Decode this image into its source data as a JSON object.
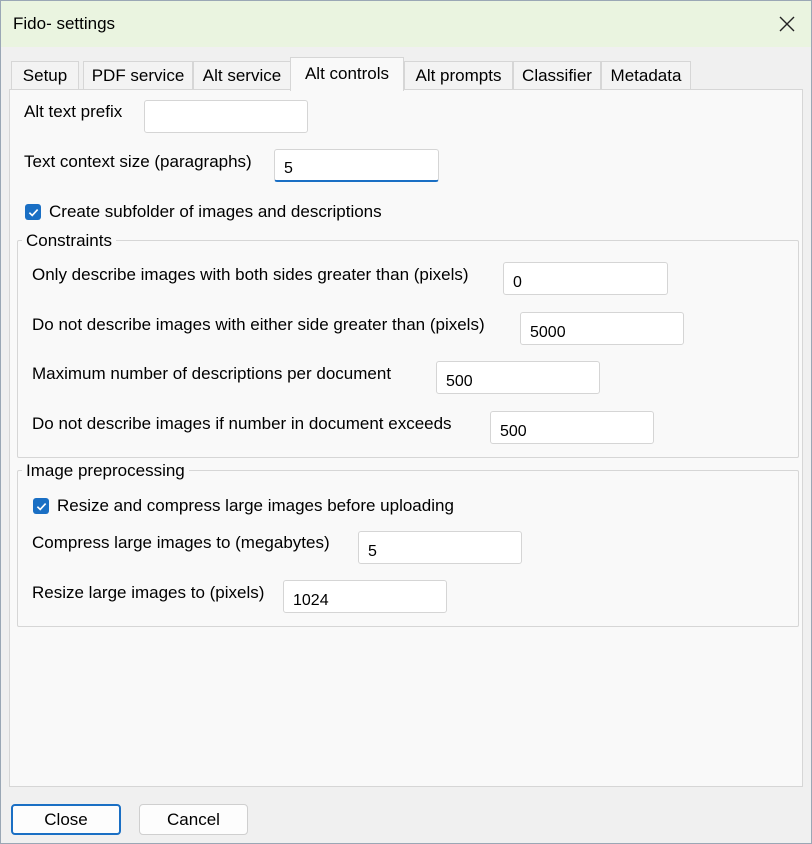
{
  "window": {
    "title": "Fido- settings"
  },
  "tabs": [
    {
      "label": "Setup",
      "active": false
    },
    {
      "label": "PDF service",
      "active": false
    },
    {
      "label": "Alt service",
      "active": false
    },
    {
      "label": "Alt controls",
      "active": true
    },
    {
      "label": "Alt prompts",
      "active": false
    },
    {
      "label": "Classifier",
      "active": false
    },
    {
      "label": "Metadata",
      "active": false
    }
  ],
  "fields": {
    "alt_text_prefix": {
      "label": "Alt text prefix",
      "value": ""
    },
    "text_context_size": {
      "label": "Text context size (paragraphs)",
      "value": "5"
    }
  },
  "create_subfolder": {
    "label": "Create subfolder of images and descriptions",
    "checked": true
  },
  "constraints": {
    "legend": "Constraints",
    "min_sides": {
      "label": "Only describe images with both sides greater than (pixels)",
      "value": "0"
    },
    "max_side": {
      "label": "Do not describe images with either side greater than (pixels)",
      "value": "5000"
    },
    "max_descriptions": {
      "label": "Maximum number of descriptions per document",
      "value": "500"
    },
    "max_images": {
      "label": "Do not describe images if number in document exceeds",
      "value": "500"
    }
  },
  "preprocessing": {
    "legend": "Image preprocessing",
    "resize_compress": {
      "label": "Resize and compress large images before uploading",
      "checked": true
    },
    "compress_to": {
      "label": "Compress large images to (megabytes)",
      "value": "5"
    },
    "resize_to": {
      "label": "Resize large images to (pixels)",
      "value": "1024"
    }
  },
  "buttons": {
    "close": "Close",
    "cancel": "Cancel"
  },
  "colors": {
    "accent": "#1a6fc4",
    "titlebar": "#eaf4e0"
  }
}
